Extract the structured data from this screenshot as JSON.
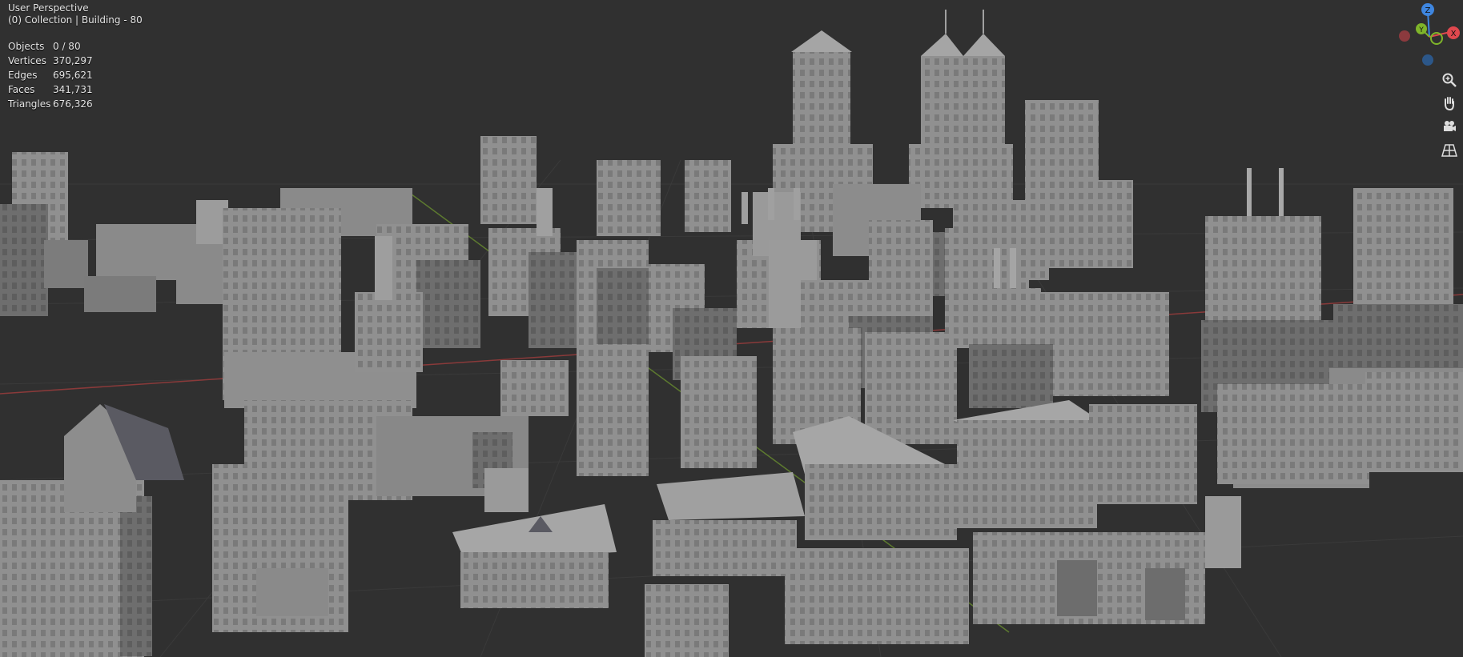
{
  "viewport": {
    "perspective_label": "User Perspective",
    "collection_label": "(0) Collection | Building - 80"
  },
  "stats": [
    {
      "label": "Objects",
      "value": "0 / 80"
    },
    {
      "label": "Vertices",
      "value": "370,297"
    },
    {
      "label": "Edges",
      "value": "695,621"
    },
    {
      "label": "Faces",
      "value": "341,731"
    },
    {
      "label": "Triangles",
      "value": "676,326"
    }
  ],
  "gizmo": {
    "z_label": "Z",
    "y_label": "Y",
    "x_label": "X"
  },
  "nav_buttons": [
    "zoom-icon",
    "pan-hand-icon",
    "camera-icon",
    "perspective-grid-icon"
  ],
  "colors": {
    "background": "#303030",
    "x_axis": "#e0484e",
    "y_axis": "#7fb52a",
    "z_axis": "#3e86e0",
    "building": "#8e8e8e"
  }
}
